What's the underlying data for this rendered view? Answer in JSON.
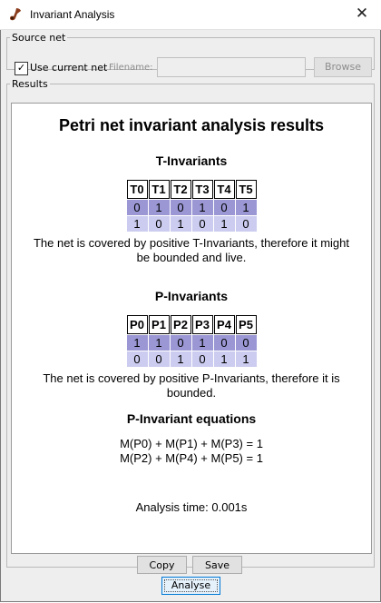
{
  "window": {
    "title": "Invariant Analysis",
    "close_glyph": "✕",
    "icon": "pipe-icon"
  },
  "source": {
    "legend": "Source net",
    "use_current_label": "Use current net",
    "use_current_checked": true,
    "check_glyph": "✓",
    "filename_label": "Filename:",
    "filename_value": "",
    "browse_label": "Browse"
  },
  "results": {
    "legend": "Results",
    "heading": "Petri net invariant analysis results",
    "t_invariants": {
      "title": "T-Invariants",
      "headers": [
        "T0",
        "T1",
        "T2",
        "T3",
        "T4",
        "T5"
      ],
      "rows": [
        [
          "0",
          "1",
          "0",
          "1",
          "0",
          "1"
        ],
        [
          "1",
          "0",
          "1",
          "0",
          "1",
          "0"
        ]
      ],
      "note": "The net is covered by positive T-Invariants, therefore it might be bounded and live."
    },
    "p_invariants": {
      "title": "P-Invariants",
      "headers": [
        "P0",
        "P1",
        "P2",
        "P3",
        "P4",
        "P5"
      ],
      "rows": [
        [
          "1",
          "1",
          "0",
          "1",
          "0",
          "0"
        ],
        [
          "0",
          "0",
          "1",
          "0",
          "1",
          "1"
        ]
      ],
      "note": "The net is covered by positive P-Invariants, therefore it is bounded."
    },
    "equations": {
      "title": "P-Invariant equations",
      "lines": [
        "M(P0) + M(P1) + M(P3) = 1",
        "M(P2) + M(P4) + M(P5) = 1"
      ]
    },
    "analysis_time": "Analysis time: 0.001s",
    "copy_label": "Copy",
    "save_label": "Save"
  },
  "analyse_label": "Analyse",
  "colors": {
    "row_even": "#9a97d4",
    "row_odd": "#ccccf0",
    "focus": "#0078d7"
  }
}
